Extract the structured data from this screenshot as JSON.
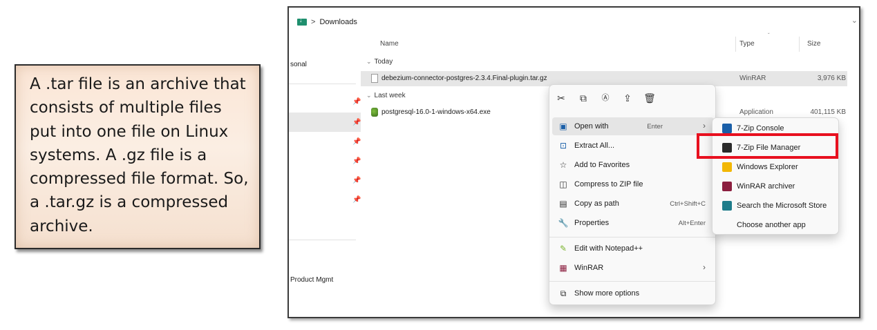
{
  "callout": {
    "text": "A .tar file is an archive that consists of multiple files put into one file on Linux systems. A .gz file is a compressed file format. So, a .tar.gz is a compressed archive."
  },
  "explorer": {
    "breadcrumb": {
      "icon": "downloads-folder-icon",
      "separator": ">",
      "location": "Downloads"
    },
    "nav": {
      "item_personal": "sonal",
      "item_product": "Product Mgmt"
    },
    "columns": {
      "name": "Name",
      "type": "Type",
      "size": "Size"
    },
    "groups": {
      "today": "Today",
      "last_week": "Last week"
    },
    "files": [
      {
        "name": "debezium-connector-postgres-2.3.4.Final-plugin.tar.gz",
        "type": "WinRAR",
        "size": "3,976 KB",
        "icon": "archive-file-icon"
      },
      {
        "name": "postgresql-16.0-1-windows-x64.exe",
        "type": "Application",
        "size": "401,115 KB",
        "icon": "installer-exe-icon"
      }
    ]
  },
  "context_menu": {
    "toolbar": [
      "cut-icon",
      "copy-icon",
      "rename-icon",
      "share-icon",
      "delete-icon"
    ],
    "items": [
      {
        "label": "Open with",
        "shortcut": "Enter",
        "has_submenu": true,
        "icon": "open-with-icon"
      },
      {
        "label": "Extract All...",
        "shortcut": "",
        "icon": "extract-icon"
      },
      {
        "label": "Add to Favorites",
        "shortcut": "",
        "icon": "star-icon"
      },
      {
        "label": "Compress to ZIP file",
        "shortcut": "",
        "icon": "zip-icon"
      },
      {
        "label": "Copy as path",
        "shortcut": "Ctrl+Shift+C",
        "icon": "copy-path-icon"
      },
      {
        "label": "Properties",
        "shortcut": "Alt+Enter",
        "icon": "properties-icon"
      },
      {
        "label": "Edit with Notepad++",
        "shortcut": "",
        "icon": "notepadpp-icon"
      },
      {
        "label": "WinRAR",
        "shortcut": "",
        "has_submenu": true,
        "icon": "winrar-icon"
      },
      {
        "label": "Show more options",
        "shortcut": "",
        "icon": "more-options-icon"
      }
    ]
  },
  "submenu": {
    "items": [
      {
        "label": "7-Zip Console",
        "icon": "seven-zip-console-icon",
        "color": "#1a5fa8"
      },
      {
        "label": "7-Zip File Manager",
        "icon": "seven-zip-file-manager-icon",
        "color": "#2b2b2b"
      },
      {
        "label": "Windows Explorer",
        "icon": "windows-explorer-icon",
        "color": "#f2b705"
      },
      {
        "label": "WinRAR archiver",
        "icon": "winrar-archiver-icon",
        "color": "#8b1e3f"
      },
      {
        "label": "Search the Microsoft Store",
        "icon": "microsoft-store-icon",
        "color": "#1e7c8a"
      },
      {
        "label": "Choose another app",
        "icon": "",
        "color": ""
      }
    ]
  },
  "highlight_color": "#e8101f"
}
